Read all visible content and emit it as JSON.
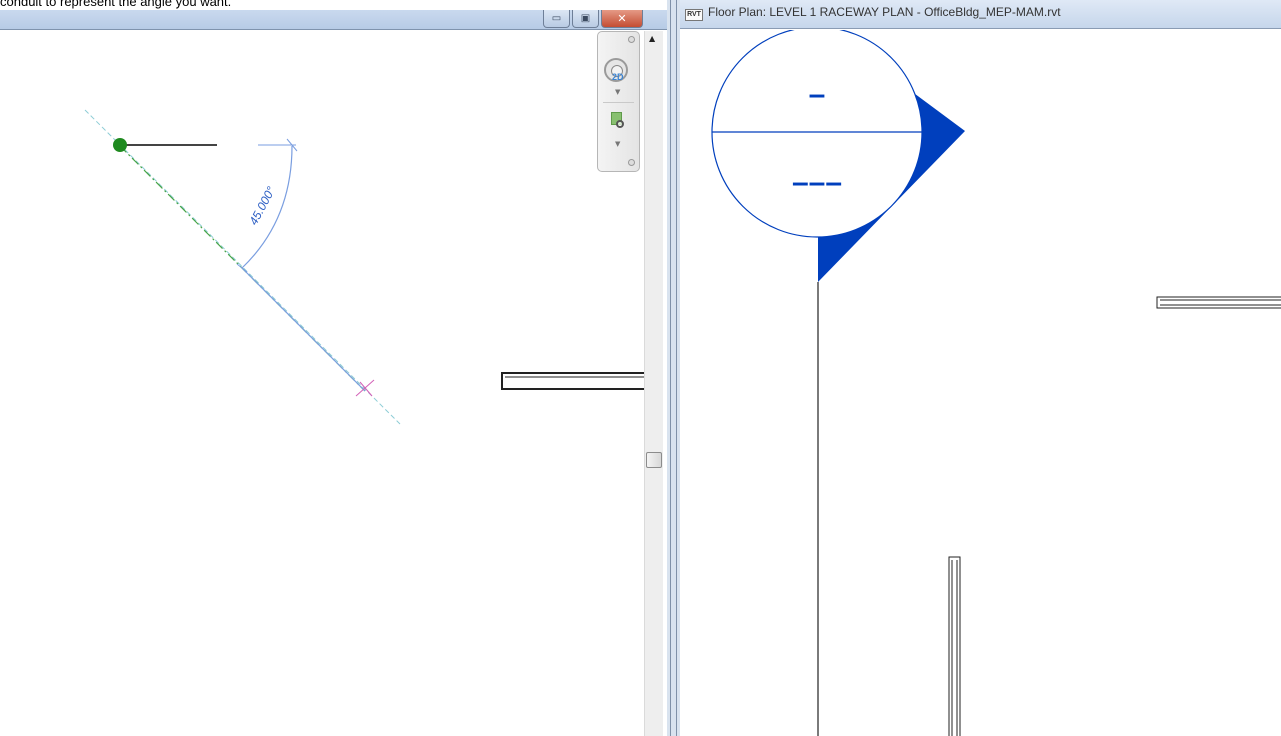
{
  "caption": "conduit to represent the angle you want.",
  "left_view": {
    "window_buttons": {
      "minimize": "▭",
      "restore": "▣",
      "close": "✕"
    },
    "angle_dimension": "45.000°",
    "navigation_bar": {
      "wheel_label": "2D",
      "icons": [
        "steering-wheel-icon",
        "zoom-region-icon"
      ]
    }
  },
  "right_view": {
    "title": "Floor Plan: LEVEL 1 RACEWAY PLAN - OfficeBldg_MEP-MAM.rvt",
    "file_icon_text": "RVT",
    "section_tag": {
      "top_text": "–",
      "bottom_text": "–––",
      "color": "#003fbd"
    }
  },
  "colors": {
    "dimension_blue": "#7a9ee0",
    "guide_cyan": "#8ecdd6",
    "guide_green": "#47a447",
    "endpoint_green": "#1f8a1f",
    "snap_magenta": "#d35fb7"
  }
}
